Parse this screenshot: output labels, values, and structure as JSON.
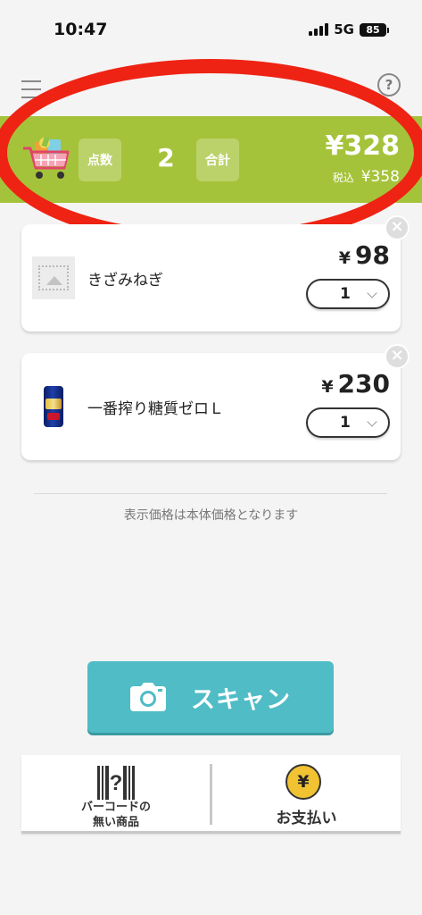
{
  "status_bar": {
    "time": "10:47",
    "network": "5G",
    "battery": "85"
  },
  "header": {
    "menu_icon": "hamburger-menu-icon",
    "help_icon": "question-mark-icon",
    "help_symbol": "?"
  },
  "summary": {
    "count_label": "点数",
    "count_value": "2",
    "total_label": "合計",
    "total_value": "¥328",
    "tax_label": "税込",
    "tax_value": "¥358",
    "background_color": "#a5c33a"
  },
  "cart": {
    "items": [
      {
        "name": "きざみねぎ",
        "currency": "¥",
        "price": "98",
        "quantity": "1",
        "remove_symbol": "×"
      },
      {
        "name": "一番搾り糖質ゼロＬ",
        "currency": "¥",
        "price": "230",
        "quantity": "1",
        "remove_symbol": "×"
      }
    ]
  },
  "price_note": "表示価格は本体価格となります",
  "scan_button": {
    "label": "スキャン",
    "color": "#4fbcc6"
  },
  "bottom_panel": {
    "no_barcode_label": "バーコードの\n無い商品",
    "payment_label": "お支払い",
    "payment_symbol": "¥"
  },
  "annotation": {
    "color": "#ee2314"
  }
}
